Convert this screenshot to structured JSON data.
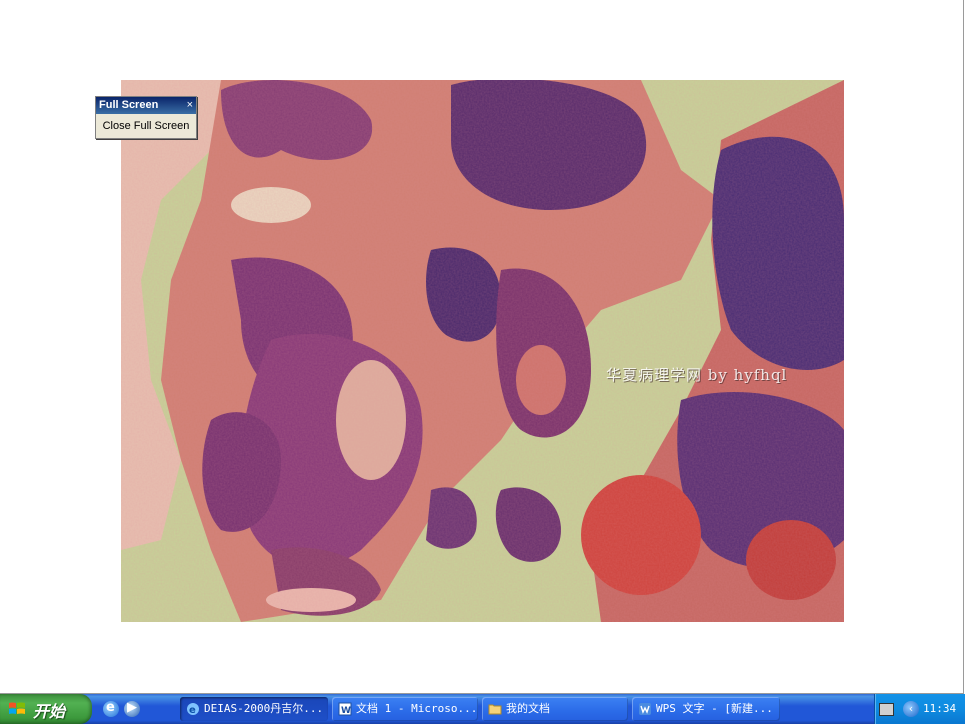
{
  "fullscreen_toolbar": {
    "title": "Full Screen",
    "close_glyph": "×",
    "button_label": "Close Full Screen"
  },
  "slide": {
    "watermark": "华夏病理学网 by hyfhql",
    "image_subject": "histology micrograph, H&E stain"
  },
  "taskbar": {
    "start_label": "开始",
    "quick_launch": [
      {
        "icon": "internet-explorer-icon"
      },
      {
        "icon": "media-player-icon"
      }
    ],
    "tasks": [
      {
        "label": "DEIAS-2000丹吉尔...",
        "icon": "ie-icon",
        "active": true
      },
      {
        "label": "文档 1 - Microso...",
        "icon": "word-icon",
        "active": false
      },
      {
        "label": "我的文档",
        "icon": "folder-icon",
        "active": false
      },
      {
        "label": "WPS 文字 - [新建...",
        "icon": "wps-icon",
        "active": false
      }
    ],
    "tray": {
      "clock": "11:34",
      "icons": [
        "keyboard-icon",
        "expand-tray-icon"
      ]
    }
  },
  "colors": {
    "taskbar_blue": "#2157d7",
    "start_green": "#3c993c",
    "tissue_purple": "#6b2f6b",
    "tissue_pink": "#d9787a",
    "background_green": "#c8d69a"
  }
}
